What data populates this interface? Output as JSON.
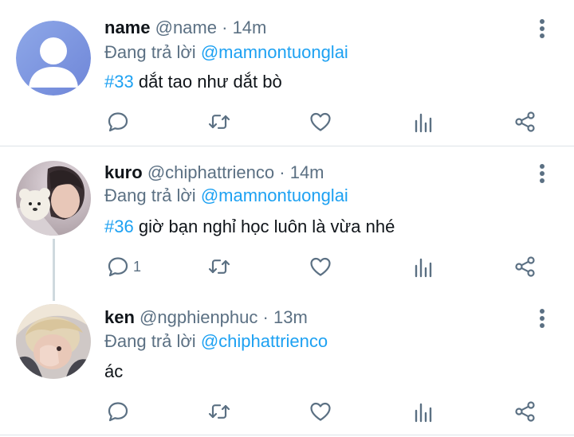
{
  "tweets": [
    {
      "name": "name",
      "handle": "@name",
      "separator": "·",
      "time": "14m",
      "reply_prefix": "Đang trả lời",
      "reply_to": "@mamnontuonglai",
      "hashtag": "#33",
      "text": " dắt tao như dắt bò",
      "reply_count": "",
      "avatar": "default-profile"
    },
    {
      "name": "kuro",
      "handle": "@chiphattrienco",
      "separator": "·",
      "time": "14m",
      "reply_prefix": "Đang trả lời",
      "reply_to": "@mamnontuonglai",
      "hashtag": "#36",
      "text": " giờ bạn nghỉ học luôn là vừa nhé",
      "reply_count": "1",
      "avatar": "photo-person-with-plush-toy"
    },
    {
      "name": "ken",
      "handle": "@ngphienphuc",
      "separator": "·",
      "time": "13m",
      "reply_prefix": "Đang trả lời",
      "reply_to": "@chiphattrienco",
      "hashtag": "",
      "text": "ác",
      "reply_count": "",
      "avatar": "photo-person-blond"
    }
  ],
  "icons": {
    "reply": "comment-icon",
    "retweet": "retweet-icon",
    "like": "heart-icon",
    "analytics": "analytics-icon",
    "share": "share-icon",
    "more": "more-vertical-icon"
  },
  "colors": {
    "accent": "#1da1f2",
    "muted": "#5b7083",
    "text": "#0f1419",
    "divider": "#dde3e8"
  }
}
